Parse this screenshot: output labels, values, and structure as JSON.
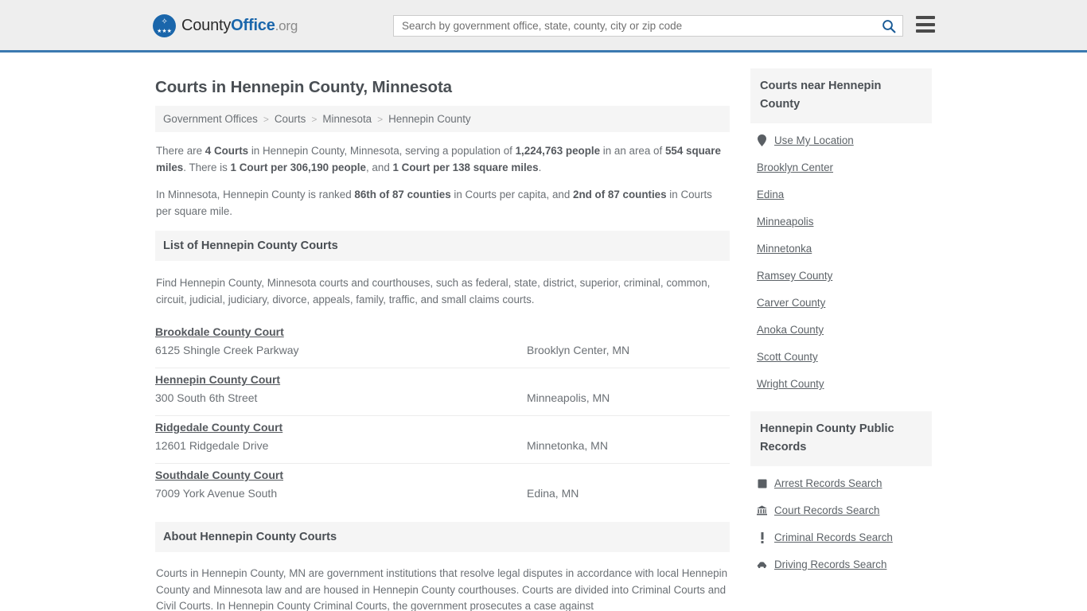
{
  "header": {
    "logo": {
      "county": "County",
      "office": "Office",
      "org": ".org",
      "eagle_glyph": "✧",
      "stars_glyph": "★★★"
    },
    "search": {
      "placeholder": "Search by government office, state, county, city or zip code",
      "value": "",
      "search_icon": "search-icon"
    },
    "menu_icon": "hamburger-menu-icon",
    "accent_color": "#3b79b0"
  },
  "main": {
    "title": "Courts in Hennepin County, Minnesota",
    "breadcrumb": [
      "Government Offices",
      "Courts",
      "Minnesota",
      "Hennepin County"
    ],
    "breadcrumb_separator": ">",
    "stats_paragraph_1": {
      "part1": "There are ",
      "b1": "4 Courts",
      "part2": " in Hennepin County, Minnesota, serving a population of ",
      "b2": "1,224,763 people",
      "part3": " in an area of ",
      "b3": "554 square miles",
      "part4": ". There is ",
      "b4": "1 Court per 306,190 people",
      "part5": ", and ",
      "b5": "1 Court per 138 square miles",
      "part6": "."
    },
    "stats_paragraph_2": {
      "part1": "In Minnesota, Hennepin County is ranked ",
      "b1": "86th of 87 counties",
      "part2": " in Courts per capita, and ",
      "b2": "2nd of 87 counties",
      "part3": " in Courts per square mile."
    },
    "list_section": {
      "heading": "List of Hennepin County Courts",
      "intro": "Find Hennepin County, Minnesota courts and courthouses, such as federal, state, district, superior, criminal, common, circuit, judicial, judiciary, divorce, appeals, family, traffic, and small claims courts.",
      "courts": [
        {
          "name": "Brookdale County Court",
          "address": "6125 Shingle Creek Parkway",
          "city": "Brooklyn Center, MN"
        },
        {
          "name": "Hennepin County Court",
          "address": "300 South 6th Street",
          "city": "Minneapolis, MN"
        },
        {
          "name": "Ridgedale County Court",
          "address": "12601 Ridgedale Drive",
          "city": "Minnetonka, MN"
        },
        {
          "name": "Southdale County Court",
          "address": "7009 York Avenue South",
          "city": "Edina, MN"
        }
      ]
    },
    "about_section": {
      "heading": "About Hennepin County Courts",
      "body": "Courts in Hennepin County, MN are government institutions that resolve legal disputes in accordance with local Hennepin County and Minnesota law and are housed in Hennepin County courthouses. Courts are divided into Criminal Courts and Civil Courts. In Hennepin County Criminal Courts, the government prosecutes a case against"
    }
  },
  "sidebar": {
    "nearby": {
      "heading": "Courts near Hennepin County",
      "use_my_location": {
        "label": "Use My Location",
        "icon": "map-pin-icon"
      },
      "places": [
        "Brooklyn Center",
        "Edina",
        "Minneapolis",
        "Minnetonka",
        "Ramsey County",
        "Carver County",
        "Anoka County",
        "Scott County",
        "Wright County"
      ]
    },
    "public_records": {
      "heading": "Hennepin County Public Records",
      "items": [
        {
          "label": "Arrest Records Search",
          "icon": "fingerprint-square-icon",
          "glyph": "■"
        },
        {
          "label": "Court Records Search",
          "icon": "courthouse-bank-icon",
          "glyph": "Ἵb"
        },
        {
          "label": "Criminal Records Search",
          "icon": "exclamation-icon",
          "glyph": "!"
        },
        {
          "label": "Driving Records Search",
          "icon": "car-icon",
          "glyph": "Ὡ7"
        }
      ]
    }
  }
}
